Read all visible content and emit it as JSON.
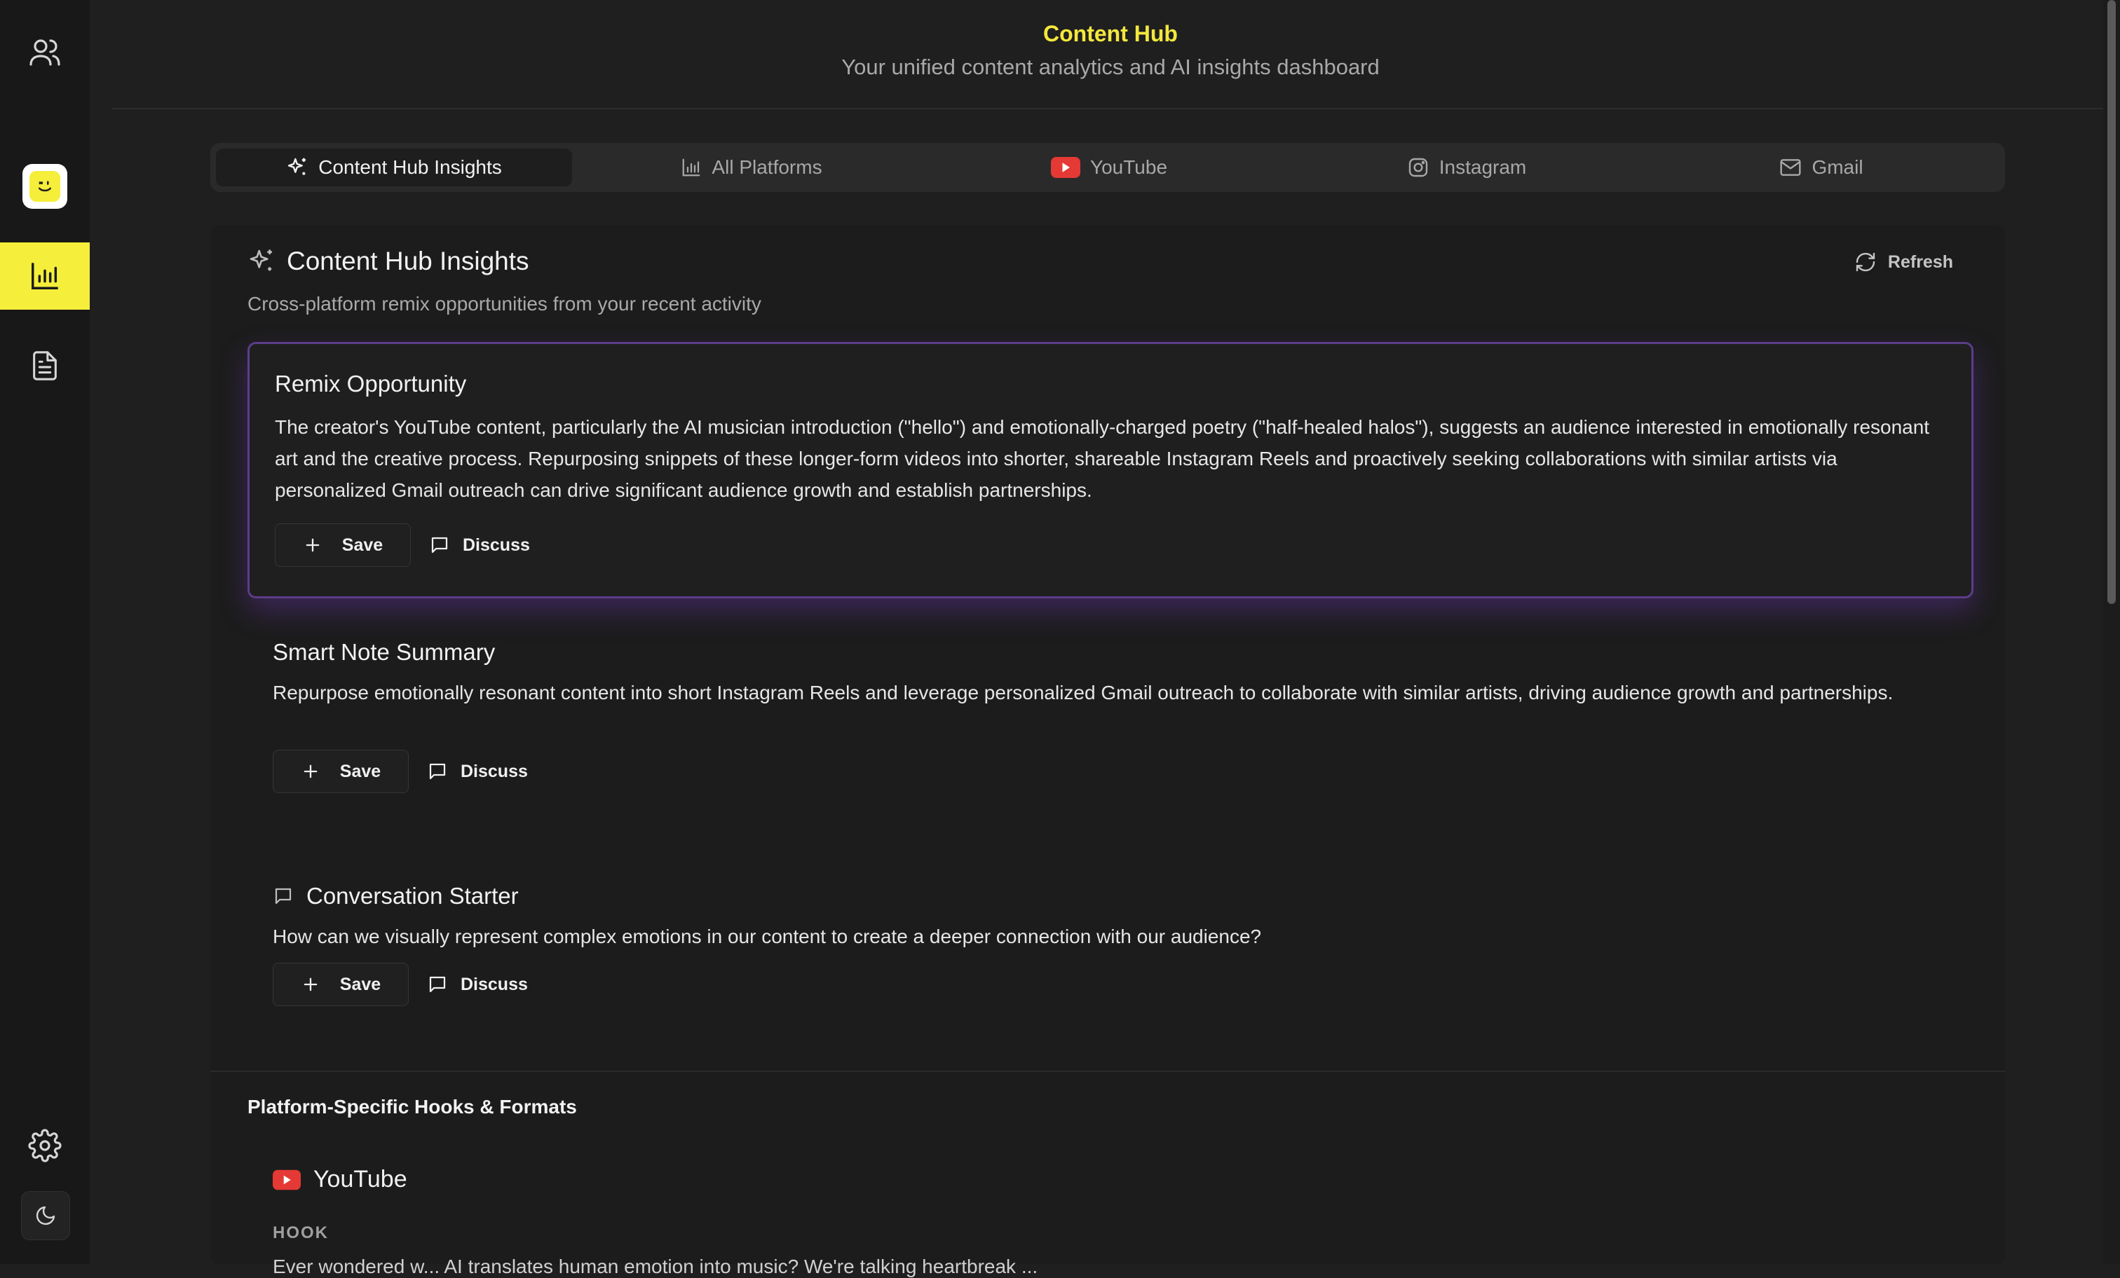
{
  "sidebar": {
    "items": [
      {
        "name": "users",
        "icon": "users-icon"
      },
      {
        "name": "logo",
        "icon": "smiley-logo-icon"
      },
      {
        "name": "analytics",
        "icon": "bar-chart-icon",
        "active": true
      },
      {
        "name": "documents",
        "icon": "document-icon"
      },
      {
        "name": "settings",
        "icon": "gear-icon"
      },
      {
        "name": "theme",
        "icon": "moon-icon"
      }
    ],
    "active_color": "#f5ee3a"
  },
  "header": {
    "title": "Content Hub",
    "subtitle": "Your unified content analytics and AI insights dashboard"
  },
  "tabs": [
    {
      "label": "Content Hub Insights",
      "icon": "sparkle-icon",
      "active": true
    },
    {
      "label": "All Platforms",
      "icon": "bar-chart-icon",
      "active": false
    },
    {
      "label": "YouTube",
      "icon": "youtube-icon",
      "active": false
    },
    {
      "label": "Instagram",
      "icon": "instagram-icon",
      "active": false
    },
    {
      "label": "Gmail",
      "icon": "mail-icon",
      "active": false
    }
  ],
  "insights": {
    "title": "Content Hub Insights",
    "subtitle": "Cross-platform remix opportunities from your recent activity",
    "refresh_label": "Refresh",
    "cards": [
      {
        "title": "Remix Opportunity",
        "body": "The creator's YouTube content, particularly the AI musician introduction (\"hello\") and emotionally-charged poetry (\"half-healed halos\"), suggests an audience interested in emotionally resonant art and the creative process. Repurposing snippets of these longer-form videos into shorter, shareable Instagram Reels and proactively seeking collaborations with similar artists via personalized Gmail outreach can drive significant audience growth and establish partnerships.",
        "save_label": "Save",
        "discuss_label": "Discuss"
      },
      {
        "title": "Smart Note Summary",
        "body": "Repurpose emotionally resonant content into short Instagram Reels and leverage personalized Gmail outreach to collaborate with similar artists, driving audience growth and partnerships.",
        "save_label": "Save",
        "discuss_label": "Discuss"
      },
      {
        "title": "Conversation Starter",
        "body": "How can we visually represent complex emotions in our content to create a deeper connection with our audience?",
        "save_label": "Save",
        "discuss_label": "Discuss"
      }
    ]
  },
  "hooks": {
    "title": "Platform-Specific Hooks & Formats",
    "platform": "YouTube",
    "label": "HOOK",
    "text_partial": "Ever wondered w... AI translates human emotion into music? We're talking heartbreak ... "
  },
  "colors": {
    "accent_yellow": "#f3e73e",
    "youtube_red": "#e53935",
    "highlight_purple": "#5c3d8a"
  }
}
